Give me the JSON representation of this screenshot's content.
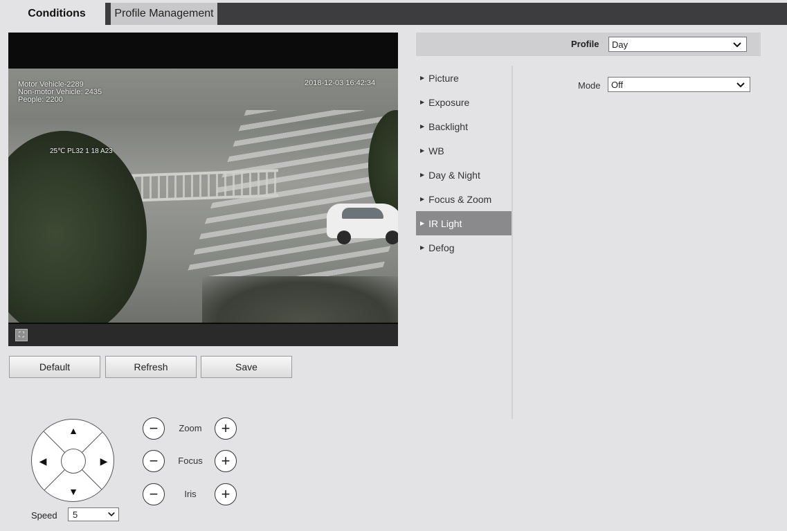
{
  "tabs": {
    "conditions": "Conditions",
    "profile_management": "Profile Management"
  },
  "video": {
    "osd_line1": "Motor Vehicle-2289",
    "osd_line2": "Non-motor Vehicle: 2435",
    "osd_line3": "People: 2200",
    "osd_timestamp": "2018-12-03 16:42:34",
    "osd_label": "25℃ PL32 1 18 A23",
    "fullscreen_glyph": "⛶"
  },
  "buttons": {
    "default": "Default",
    "refresh": "Refresh",
    "save": "Save"
  },
  "ptz": {
    "up": "▲",
    "down": "▼",
    "left": "◀",
    "right": "▶",
    "speed_label": "Speed",
    "speed_value": "5",
    "zoom_label": "Zoom",
    "focus_label": "Focus",
    "iris_label": "Iris",
    "minus": "−",
    "plus": "+"
  },
  "profile": {
    "label": "Profile",
    "value": "Day"
  },
  "menu": {
    "items": [
      {
        "label": "Picture"
      },
      {
        "label": "Exposure"
      },
      {
        "label": "Backlight"
      },
      {
        "label": "WB"
      },
      {
        "label": "Day & Night"
      },
      {
        "label": "Focus & Zoom"
      },
      {
        "label": "IR Light"
      },
      {
        "label": "Defog"
      }
    ],
    "active": "IR Light"
  },
  "mode": {
    "label": "Mode",
    "value": "Off"
  },
  "icons": {
    "chevron": "chevron-down-icon",
    "menu_triangle": "triangle-right-icon"
  }
}
